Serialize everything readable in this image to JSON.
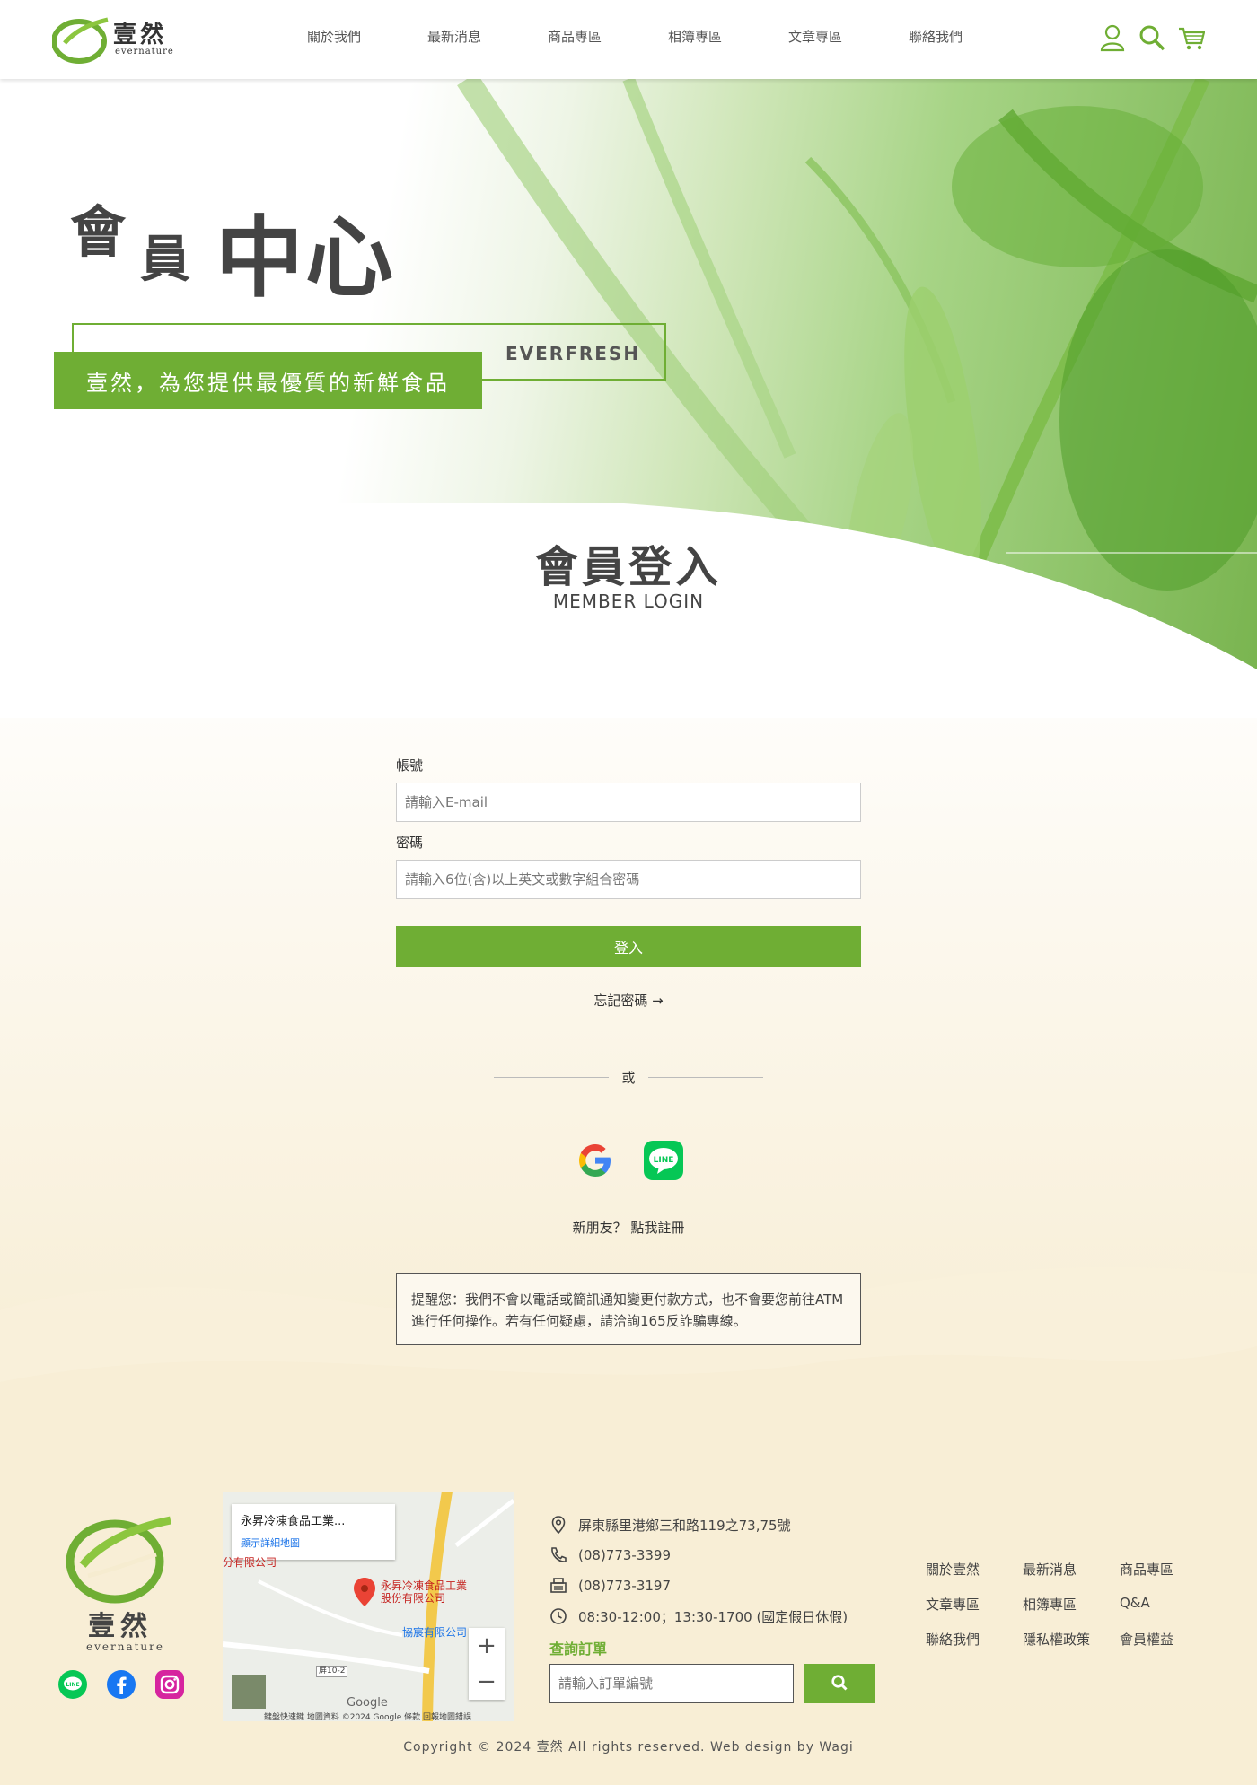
{
  "brand": {
    "name": "壹然",
    "sub": "evernature"
  },
  "nav": {
    "items": [
      "關於我們",
      "最新消息",
      "商品專區",
      "相簿專區",
      "文章專區",
      "聯絡我們"
    ]
  },
  "hero": {
    "title_1": "會",
    "title_2": "員",
    "title_3": "中心",
    "tag": "EVERFRESH",
    "slogan": "壹然，為您提供最優質的新鮮食品"
  },
  "login": {
    "title": "會員登入",
    "subtitle": "MEMBER LOGIN",
    "account_label": "帳號",
    "account_placeholder": "請輸入E-mail",
    "password_label": "密碼",
    "password_placeholder": "請輸入6位(含)以上英文或數字組合密碼",
    "submit_label": "登入",
    "forgot_label": "忘記密碼 →",
    "or_label": "或",
    "register_prefix": "新朋友？",
    "register_link": "點我註冊",
    "notice": "提醒您：我們不會以電話或簡訊通知變更付款方式，也不會要您前往ATM進行任何操作。若有任何疑慮，請洽詢165反詐騙專線。"
  },
  "footer": {
    "map": {
      "card_title": "永昇冷凍食品工業...",
      "card_link": "顯示詳細地圖",
      "pin_label_1": "永昇冷凍食品工業",
      "pin_label_2": "股份有限公司",
      "place_label": "協宸有限公司",
      "place_label_2": "分有限公司",
      "road_label": "屏10-2",
      "google": "Google",
      "attribution": "鍵盤快速鍵  地圖資料 ©2024 Google  條款  回報地圖錯誤"
    },
    "contact": {
      "address": "屏東縣里港鄉三和路119之73,75號",
      "phone": "(08)773-3399",
      "fax": "(08)773-3197",
      "hours": "08:30-12:00；13:30-1700 (國定假日休假)"
    },
    "order": {
      "title": "查詢訂單",
      "placeholder": "請輸入訂單編號"
    },
    "links": [
      "關於壹然",
      "最新消息",
      "商品專區",
      "文章專區",
      "相簿專區",
      "Q&A",
      "聯絡我們",
      "隱私權政策",
      "會員權益"
    ],
    "copyright": "Copyright © 2024 壹然 All rights reserved. Web design by Wagi"
  },
  "colors": {
    "accent": "#6fae34",
    "text": "#333333",
    "cream": "#f6ecd0"
  },
  "icons": [
    "user-icon",
    "search-icon",
    "cart-icon",
    "google-icon",
    "line-icon",
    "facebook-icon",
    "instagram-icon",
    "location-icon",
    "phone-icon",
    "fax-icon",
    "clock-icon"
  ]
}
